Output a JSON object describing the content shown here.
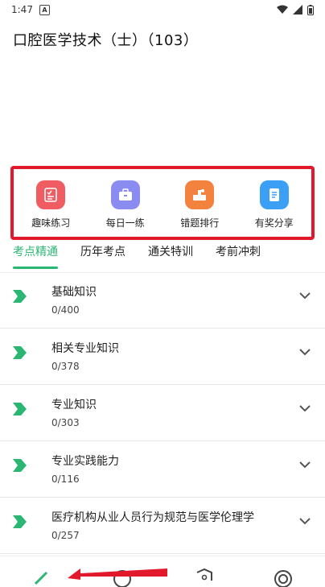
{
  "status_bar": {
    "time": "1:47"
  },
  "page": {
    "title": "口腔医学技术（士）（103）"
  },
  "features": [
    {
      "label": "趣味练习",
      "icon": "checklist-icon",
      "color": "#ef5d63"
    },
    {
      "label": "每日一练",
      "icon": "briefcase-icon",
      "color": "#8a8cf2"
    },
    {
      "label": "错题排行",
      "icon": "ranking-icon",
      "color": "#f3823f"
    },
    {
      "label": "有奖分享",
      "icon": "notebook-icon",
      "color": "#3a9ff5"
    }
  ],
  "tabs": [
    {
      "label": "考点精通",
      "active": true
    },
    {
      "label": "历年考点",
      "active": false
    },
    {
      "label": "通关特训",
      "active": false
    },
    {
      "label": "考前冲刺",
      "active": false
    }
  ],
  "sections": [
    {
      "title": "基础知识",
      "progress": "0/400"
    },
    {
      "title": "相关专业知识",
      "progress": "0/378"
    },
    {
      "title": "专业知识",
      "progress": "0/303"
    },
    {
      "title": "专业实践能力",
      "progress": "0/116"
    },
    {
      "title": "医疗机构从业人员行为规范与医学伦理学",
      "progress": "0/257"
    }
  ],
  "colors": {
    "accent": "#2bb673",
    "highlight_box": "#e2192c"
  }
}
